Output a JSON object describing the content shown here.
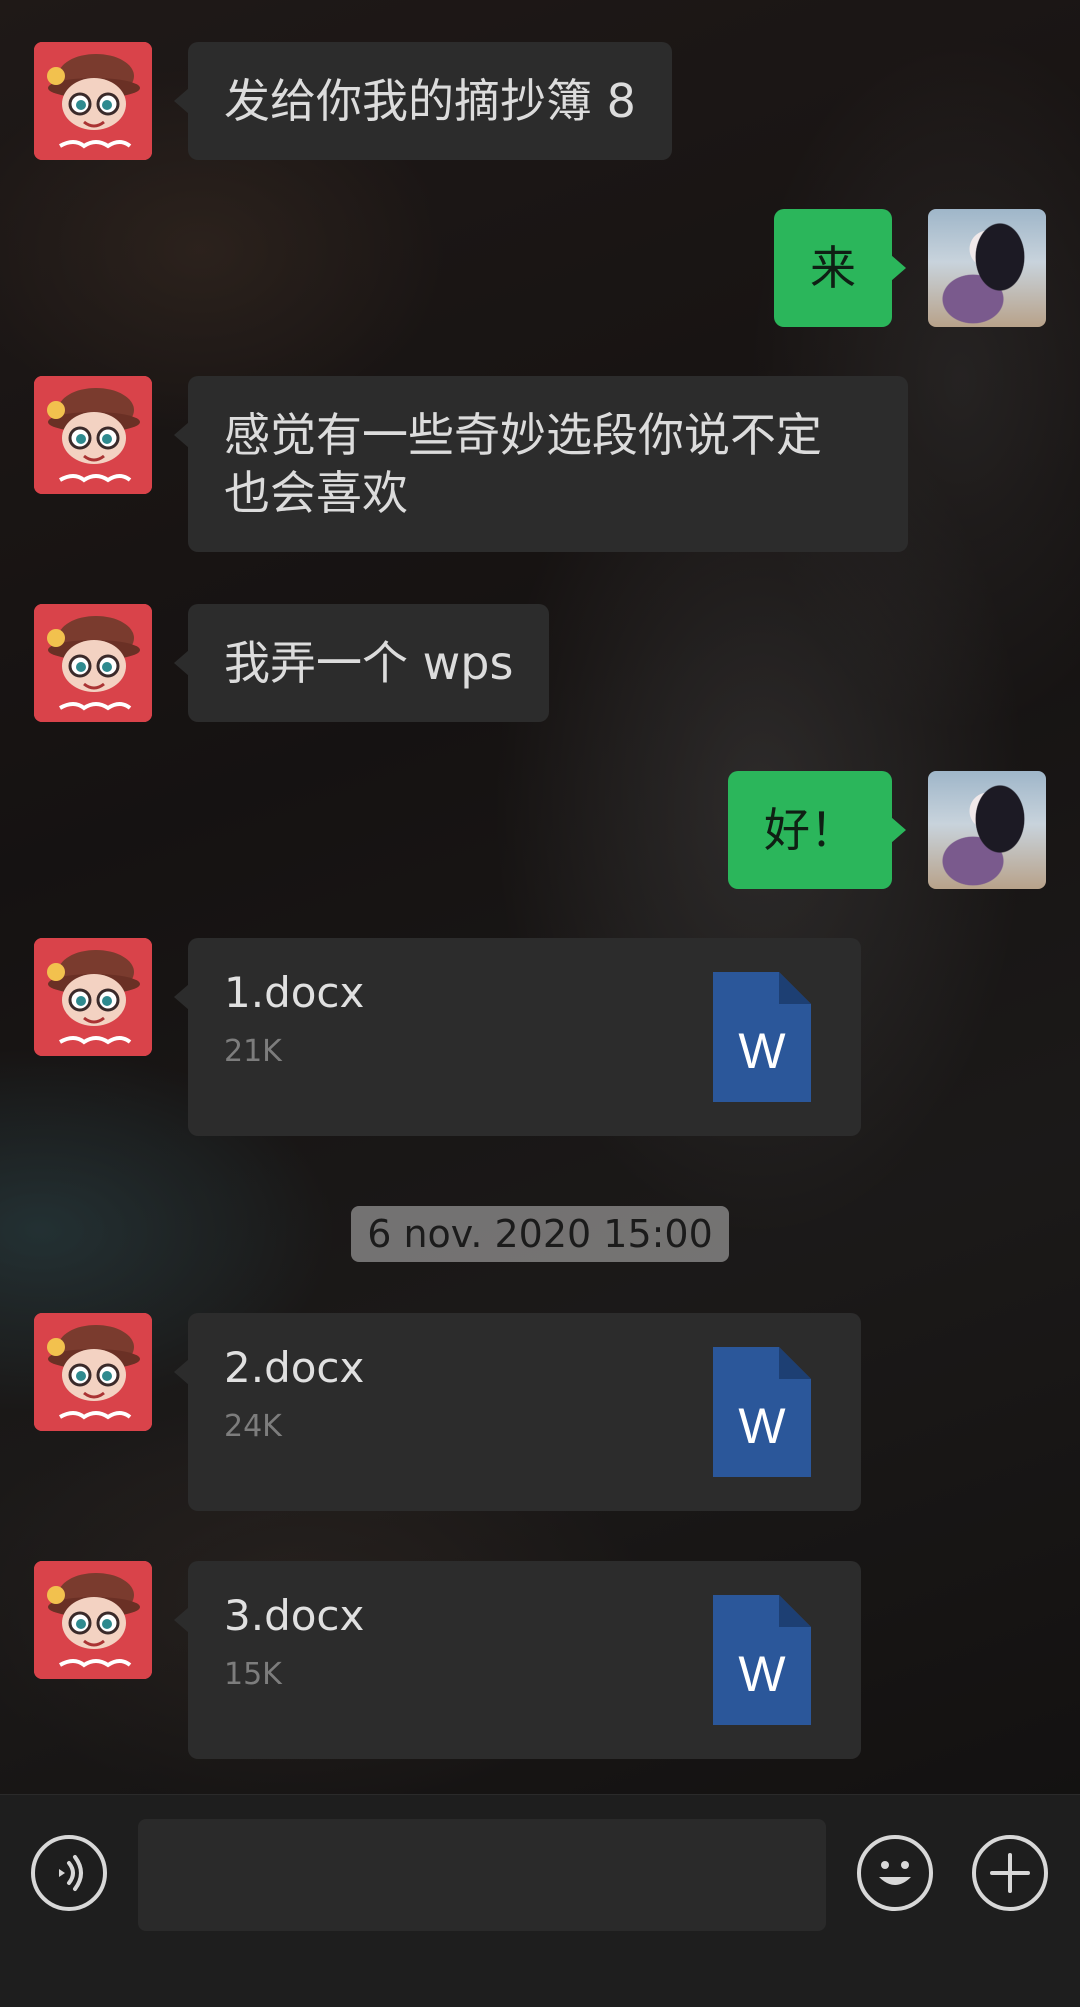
{
  "messages": [
    {
      "side": "in",
      "text": "发给你我的摘抄簿 8"
    },
    {
      "side": "out",
      "text": "来"
    },
    {
      "side": "in",
      "text_line1": "感觉有一些奇妙选段你说不定",
      "text_line2": "也会喜欢"
    },
    {
      "side": "in",
      "text": "我弄一个 wps"
    },
    {
      "side": "out",
      "text": "好！"
    }
  ],
  "files": [
    {
      "name": "1.docx",
      "size": "21K",
      "icon_letter": "W"
    },
    {
      "name": "2.docx",
      "size": "24K",
      "icon_letter": "W"
    },
    {
      "name": "3.docx",
      "size": "15K",
      "icon_letter": "W"
    }
  ],
  "timestamp": "6 nov. 2020 15:00",
  "input": {
    "placeholder": "",
    "value": ""
  },
  "icons": {
    "voice": "voice-icon",
    "emoji": "emoji-icon",
    "plus": "plus-icon",
    "word": "word-document-icon"
  },
  "colors": {
    "outgoing_bubble": "#2bb65b",
    "incoming_bubble": "#2c2c2c",
    "word_icon": "#2b579a",
    "avatar_bg": "#d9434a"
  }
}
